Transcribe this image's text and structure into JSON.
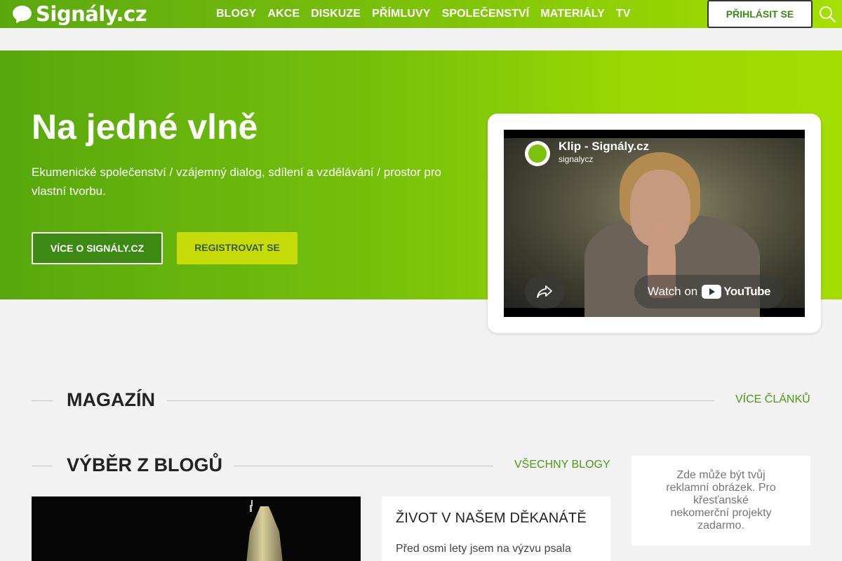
{
  "header": {
    "logo_text": "Signály.cz",
    "nav": [
      "BLOGY",
      "AKCE",
      "DISKUZE",
      "PŘÍMLUVY",
      "SPOLEČENSTVÍ",
      "MATERIÁLY",
      "TV"
    ],
    "login_label": "PŘIHLÁSIT SE"
  },
  "hero": {
    "title": "Na jedné vlně",
    "subtitle": "Ekumenické společenství / vzájemný dialog, sdílení a vzdělávání / prostor pro vlastní tvorbu.",
    "btn_more": "VÍCE O SIGNÁLY.CZ",
    "btn_register": "REGISTROVAT SE"
  },
  "video": {
    "title": "Klip - Signály.cz",
    "channel": "signalycz",
    "watch_on": "Watch on",
    "youtube": "YouTube"
  },
  "magazine": {
    "title": "MAGAZÍN",
    "link": "VÍCE ČLÁNKŮ"
  },
  "blogs": {
    "title": "VÝBĚR Z BLOGŮ",
    "link": "VŠECHNY BLOGY",
    "card": {
      "title": "ŽIVOT V NAŠEM DĚKANÁTĚ",
      "excerpt": "Před osmi lety jsem na výzvu psala"
    }
  },
  "ad": {
    "text": "Zde může být tvůj reklamní obrázek. Pro křesťanské nekomerční projekty zadarmo."
  },
  "colors": {
    "brand_green": "#5aa80f",
    "brand_lime": "#a3dd00",
    "link_green": "#4d9a16",
    "register_button": "#c5dc08"
  }
}
